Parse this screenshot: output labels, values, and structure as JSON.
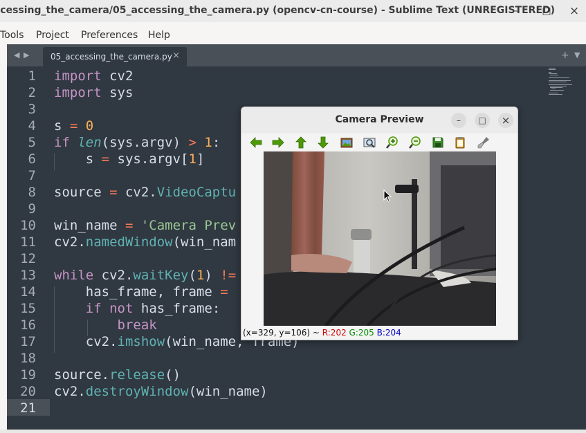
{
  "window": {
    "title": "ccessing_the_camera/05_accessing_the_camera.py (opencv-cn-course) - Sublime Text (UNREGISTERED)",
    "minimize": "–",
    "maximize": "□",
    "close": "×"
  },
  "menu": {
    "items": [
      "Tools",
      "Project",
      "Preferences",
      "Help"
    ]
  },
  "tabs": {
    "nav_left": "◀",
    "nav_right": "▶",
    "items": [
      {
        "label": "05_accessing_the_camera.py",
        "close": "×",
        "active": true
      }
    ],
    "new_tab": "+",
    "dropdown": "▼"
  },
  "editor": {
    "current_line": 21,
    "line_numbers": [
      "1",
      "2",
      "3",
      "4",
      "5",
      "6",
      "7",
      "8",
      "9",
      "10",
      "11",
      "12",
      "13",
      "14",
      "15",
      "16",
      "17",
      "18",
      "19",
      "20",
      "21"
    ],
    "code": [
      [
        [
          "kw",
          "import"
        ],
        [
          "t",
          " cv2"
        ]
      ],
      [
        [
          "kw",
          "import"
        ],
        [
          "t",
          " sys"
        ]
      ],
      [],
      [
        [
          "t",
          "s "
        ],
        [
          "op",
          "="
        ],
        [
          "t",
          " "
        ],
        [
          "num",
          "0"
        ]
      ],
      [
        [
          "kw",
          "if"
        ],
        [
          "t",
          " "
        ],
        [
          "it",
          "len"
        ],
        [
          "t",
          "(sys.argv) "
        ],
        [
          "op",
          ">"
        ],
        [
          "t",
          " "
        ],
        [
          "num",
          "1"
        ],
        [
          "t",
          ":"
        ]
      ],
      [
        [
          "t",
          "    s "
        ],
        [
          "op",
          "="
        ],
        [
          "t",
          " sys.argv["
        ],
        [
          "num",
          "1"
        ],
        [
          "t",
          "]"
        ]
      ],
      [],
      [
        [
          "t",
          "source "
        ],
        [
          "op",
          "="
        ],
        [
          "t",
          " cv2."
        ],
        [
          "fn",
          "VideoCaptu"
        ]
      ],
      [],
      [
        [
          "t",
          "win_name "
        ],
        [
          "op",
          "="
        ],
        [
          "t",
          " "
        ],
        [
          "str",
          "'Camera Prev"
        ]
      ],
      [
        [
          "t",
          "cv2."
        ],
        [
          "fn",
          "namedWindow"
        ],
        [
          "t",
          "(win_nam"
        ]
      ],
      [],
      [
        [
          "kw",
          "while"
        ],
        [
          "t",
          " cv2."
        ],
        [
          "fn",
          "waitKey"
        ],
        [
          "t",
          "("
        ],
        [
          "num",
          "1"
        ],
        [
          "t",
          ") "
        ],
        [
          "op",
          "!="
        ]
      ],
      [
        [
          "t",
          "    has_frame, frame "
        ],
        [
          "op",
          "="
        ]
      ],
      [
        [
          "t",
          "    "
        ],
        [
          "kw",
          "if"
        ],
        [
          "t",
          " "
        ],
        [
          "kw",
          "not"
        ],
        [
          "t",
          " has_frame:"
        ]
      ],
      [
        [
          "t",
          "        "
        ],
        [
          "kw",
          "break"
        ]
      ],
      [
        [
          "t",
          "    cv2."
        ],
        [
          "fn",
          "imshow"
        ],
        [
          "t",
          "(win_name, frame)"
        ]
      ],
      [],
      [
        [
          "t",
          "source."
        ],
        [
          "fn",
          "release"
        ],
        [
          "t",
          "()"
        ]
      ],
      [
        [
          "t",
          "cv2."
        ],
        [
          "fn",
          "destroyWindow"
        ],
        [
          "t",
          "(win_name)"
        ]
      ],
      []
    ]
  },
  "colors": {
    "editor_bg": "#303841",
    "keyword": "#c594c5",
    "function": "#5fb3b3",
    "number": "#f9ae58",
    "operator": "#f97b58",
    "string": "#99c794"
  },
  "camera_window": {
    "title": "Camera Preview",
    "minimize": "–",
    "maximize": "□",
    "close": "×",
    "toolbar": [
      "pan-left-icon",
      "pan-right-icon",
      "pan-up-icon",
      "pan-down-icon",
      "thumbnail-icon",
      "zoom-fit-icon",
      "zoom-in-icon",
      "zoom-out-icon",
      "save-icon",
      "copy-icon",
      "properties-icon"
    ],
    "status": {
      "coords": "(x=329, y=106) ~ ",
      "r": "R:202",
      "g": "G:205",
      "b": "B:204"
    }
  }
}
